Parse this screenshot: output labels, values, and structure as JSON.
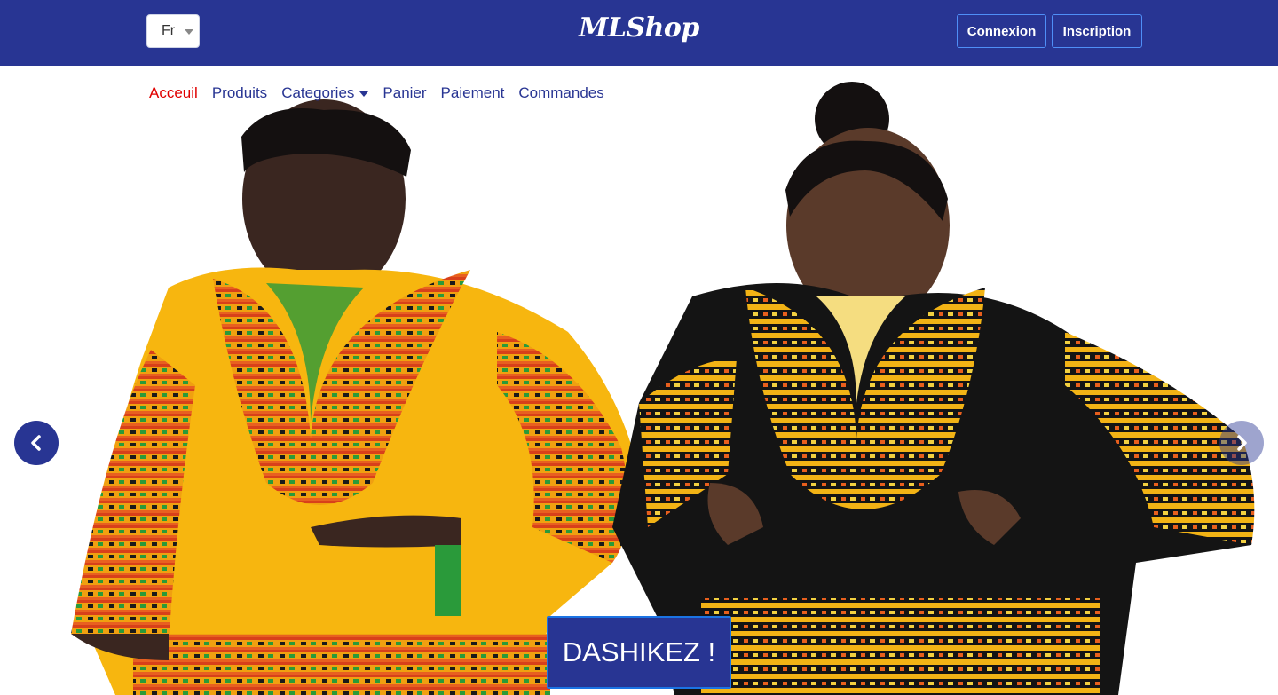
{
  "header": {
    "brand": "MLShop",
    "language": {
      "selected": "Fr"
    },
    "login_label": "Connexion",
    "signup_label": "Inscription"
  },
  "nav": {
    "items": [
      {
        "label": "Acceuil",
        "active": true
      },
      {
        "label": "Produits"
      },
      {
        "label": "Categories",
        "dropdown": true
      },
      {
        "label": "Panier"
      },
      {
        "label": "Paiement"
      },
      {
        "label": "Commandes"
      }
    ]
  },
  "carousel": {
    "caption_button": "DASHIKEZ !",
    "prev_icon": "chevron-left-icon",
    "next_icon": "chevron-right-icon"
  },
  "colors": {
    "primary": "#283593",
    "active_nav": "#e00000",
    "outline": "#4f8ff7"
  }
}
